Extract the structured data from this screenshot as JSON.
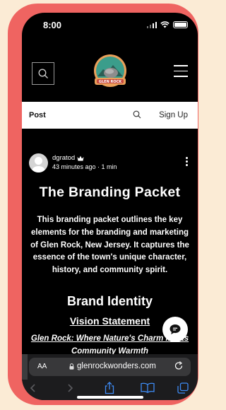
{
  "status_bar": {
    "time": "8:00"
  },
  "subnav": {
    "post_label": "Post",
    "signup_label": "Sign Up"
  },
  "logo": {
    "text": "GLEN ROCK"
  },
  "post": {
    "author": "dgratod",
    "meta": "43 minutes ago · 1 min",
    "title": "The Branding Packet",
    "intro": "This branding packet outlines the key elements for the branding and marketing of Glen Rock, New Jersey. It captures the essence of the town's unique character, history, and community spirit.",
    "section_heading": "Brand Identity",
    "sub_heading": "Vision Statement",
    "tagline": "Glen Rock: Where Nature's Charm Meets Community Warmth"
  },
  "browser": {
    "aa_label": "AA",
    "url": "glenrockwonders.com"
  },
  "colors": {
    "frame": "#ef6461",
    "background": "#fbebd5",
    "logo_accent": "#3b9d8b"
  }
}
